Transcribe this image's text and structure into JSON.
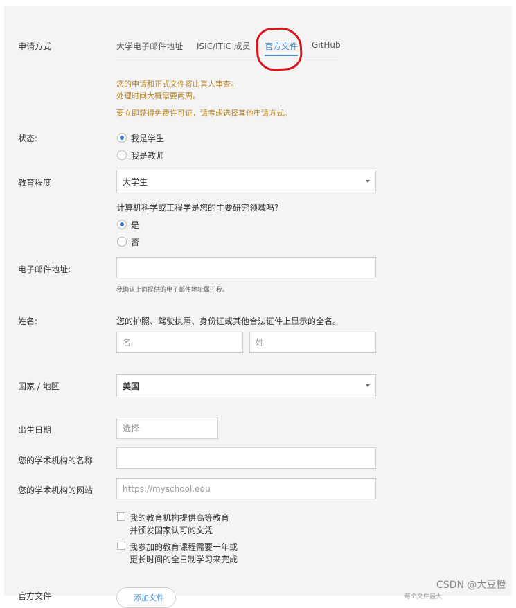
{
  "form": {
    "method_label": "申请方式",
    "tabs": [
      {
        "label": "大学电子邮件地址"
      },
      {
        "label": "ISIC/ITIC 成员"
      },
      {
        "label": "官方文件"
      },
      {
        "label": "GitHub"
      }
    ],
    "active_tab": "官方文件",
    "notes": {
      "line1": "您的申请和正式文件将由真人审查。",
      "line2": "处理时间大概需要两周。",
      "line3": "要立即获得免费许可证，请考虑选择其他申请方式。"
    },
    "status": {
      "label": "状态:",
      "options": [
        {
          "label": "我是学生",
          "checked": true
        },
        {
          "label": "我是教师",
          "checked": false
        }
      ]
    },
    "education": {
      "label": "教育程度",
      "value": "大学生"
    },
    "cs_question": {
      "text": "计算机科学或工程学是您的主要研究领域吗?",
      "options": [
        {
          "label": "是",
          "checked": true
        },
        {
          "label": "否",
          "checked": false
        }
      ]
    },
    "email": {
      "label": "电子邮件地址:",
      "value": "",
      "hint": "我确认上面提供的电子邮件地址属于我。"
    },
    "name": {
      "label": "姓名:",
      "instruction": "您的护照、驾驶执照、身份证或其他合法证件上显示的全名。",
      "first_placeholder": "名",
      "last_placeholder": "姓"
    },
    "country": {
      "label": "国家 / 地区",
      "value": "美国"
    },
    "birth": {
      "label": "出生日期",
      "placeholder": "选择"
    },
    "institution_name": {
      "label": "您的学术机构的名称",
      "value": ""
    },
    "institution_site": {
      "label": "您的学术机构的网站",
      "placeholder": "https://myschool.edu"
    },
    "checkboxes": [
      {
        "line1": "我的教育机构提供高等教育",
        "line2": "并颁发国家认可的文凭",
        "checked": false
      },
      {
        "line1": "我参加的教育课程需要一年或",
        "line2": "更长时间的全日制学习来完成",
        "checked": false
      }
    ],
    "document": {
      "label": "官方文件",
      "button": "添加文件",
      "side_text": "每个文件最大"
    }
  },
  "watermark": "CSDN @大豆橙",
  "colors": {
    "accent": "#4a90d9",
    "note": "#b8862b",
    "annotation": "#d8141c",
    "panel": "#f4f4f4"
  }
}
